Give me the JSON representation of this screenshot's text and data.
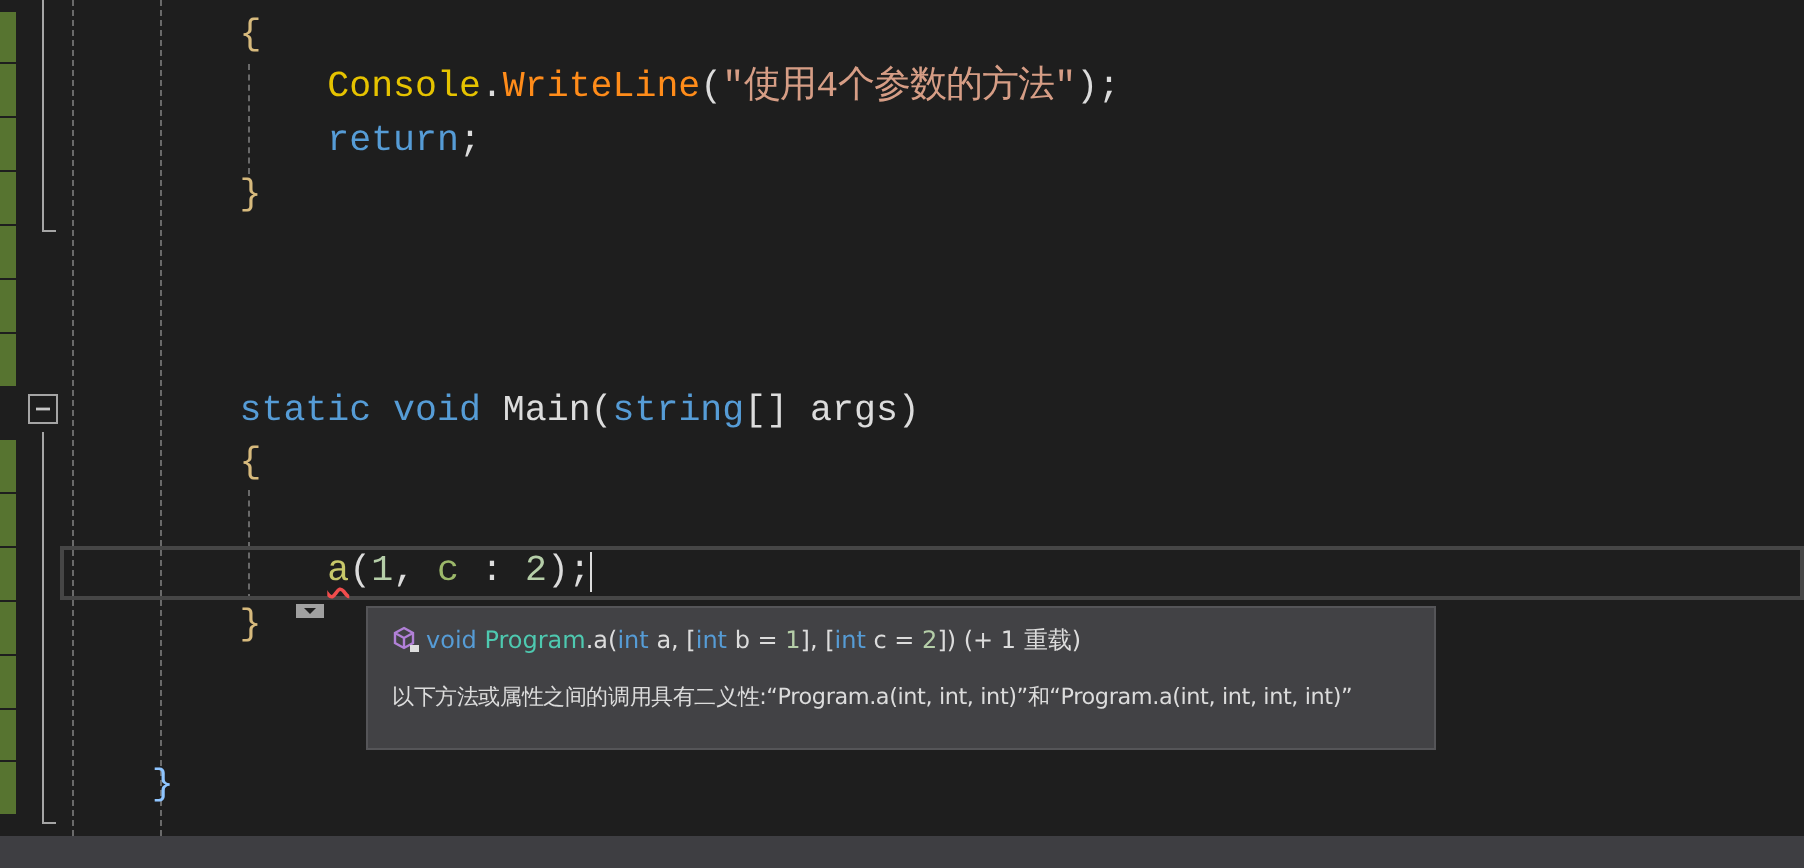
{
  "code_lines": [
    {
      "children": [
        {
          "changed": true,
          "tokens": [
            {
              "kind": "brace",
              "text": "{"
            }
          ]
        },
        {
          "children": [
            {
              "changed": true,
              "tokens": [
                {
                  "kind": "class",
                  "text": "Console"
                },
                {
                  "kind": "punct",
                  "text": "."
                },
                {
                  "kind": "method",
                  "text": "WriteLine"
                },
                {
                  "kind": "punct",
                  "text": "("
                },
                {
                  "kind": "string",
                  "text": "\"使用4个参数的方法\""
                },
                {
                  "kind": "punct",
                  "text": ");"
                }
              ]
            },
            {
              "changed": true,
              "tokens": [
                {
                  "kind": "keyword",
                  "text": "return"
                },
                {
                  "kind": "punct",
                  "text": ";"
                }
              ]
            }
          ]
        },
        {
          "changed": true,
          "tokens": [
            {
              "kind": "brace",
              "text": "}"
            }
          ]
        },
        {
          "changed": true
        },
        {
          "changed": true
        },
        {
          "changed": true
        },
        {
          "changed": false,
          "fold": {
            "expanded": true
          },
          "tokens": [
            {
              "kind": "keyword",
              "text": "static"
            },
            {
              "kind": "keyword",
              "text": " void"
            },
            {
              "kind": "ident",
              "text": " Main"
            },
            {
              "kind": "punct",
              "text": "("
            },
            {
              "kind": "keyword",
              "text": "string"
            },
            {
              "kind": "punct",
              "text": "[]"
            },
            {
              "kind": "ident",
              "text": " args"
            },
            {
              "kind": "punct",
              "text": ")"
            }
          ]
        },
        {
          "changed": true,
          "tokens": [
            {
              "kind": "brace",
              "text": "{"
            }
          ]
        },
        {
          "children": [
            {
              "changed": true
            },
            {
              "changed": true,
              "current": true,
              "tokens": [
                {
                  "kind": "call",
                  "text": "a",
                  "error": true
                },
                {
                  "kind": "punct",
                  "text": "("
                },
                {
                  "kind": "number",
                  "text": "1"
                },
                {
                  "kind": "punct",
                  "text": ","
                },
                {
                  "kind": "param",
                  "text": " c"
                },
                {
                  "kind": "punct",
                  "text": " : "
                },
                {
                  "kind": "number",
                  "text": "2"
                },
                {
                  "kind": "punct",
                  "text": ");"
                }
              ]
            }
          ]
        },
        {
          "changed": true,
          "tokens": [
            {
              "kind": "brace",
              "text": "}"
            }
          ]
        },
        {
          "changed": true
        },
        {
          "changed": true
        }
      ]
    },
    {
      "changed": true,
      "tokens": [
        {
          "kind": "brace2",
          "text": "}"
        }
      ]
    }
  ],
  "tooltip": {
    "signature": [
      {
        "kind": "keyword",
        "text": "void"
      },
      {
        "kind": "type",
        "text": " Program"
      },
      {
        "kind": "plain",
        "text": ".a("
      },
      {
        "kind": "keyword",
        "text": "int"
      },
      {
        "kind": "plain",
        "text": " a, ["
      },
      {
        "kind": "keyword",
        "text": "int"
      },
      {
        "kind": "plain",
        "text": " b = "
      },
      {
        "kind": "number",
        "text": "1"
      },
      {
        "kind": "plain",
        "text": "], ["
      },
      {
        "kind": "keyword",
        "text": "int"
      },
      {
        "kind": "plain",
        "text": " c = "
      },
      {
        "kind": "number",
        "text": "2"
      },
      {
        "kind": "plain",
        "text": "]) (+ 1 重载)"
      }
    ],
    "message": "以下方法或属性之间的调用具有二义性:“Program.a(int, int, int)”和“Program.a(int, int, int, int)”"
  }
}
